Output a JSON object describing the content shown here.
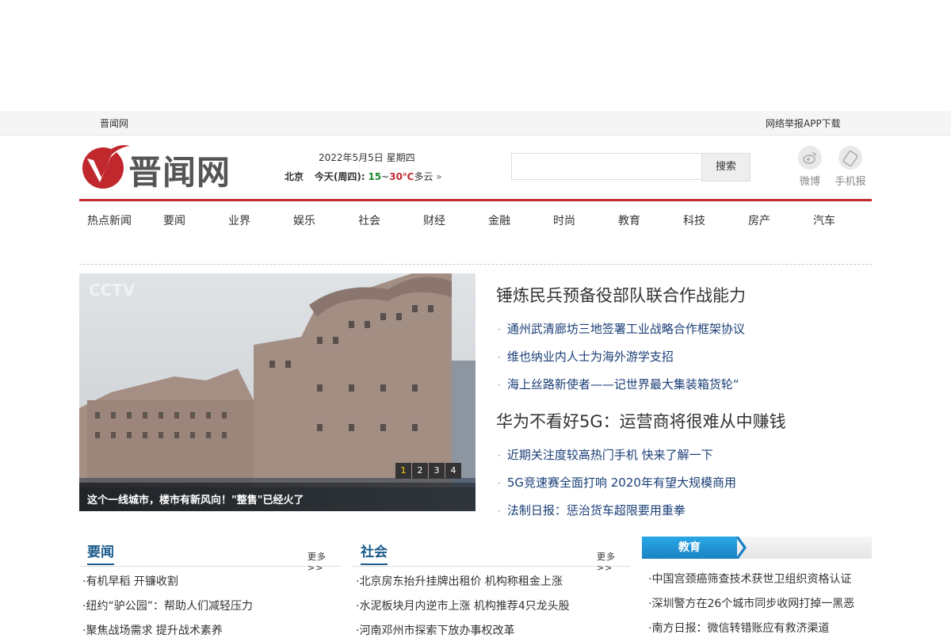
{
  "topbar": {
    "site_name": "晋闻网",
    "app_link": "网络举报APP下载"
  },
  "header": {
    "logo_text": "晋闻网",
    "date": "2022年5月5日  星期四",
    "weather": {
      "city": "北京",
      "today": "今天(周四):",
      "low": "15",
      "sep": "~",
      "high": "30℃",
      "cond": "多云",
      "arrow": "»"
    },
    "search": {
      "placeholder": "",
      "button": "搜索"
    },
    "icons": {
      "weibo": "微博",
      "mobile": "手机报"
    }
  },
  "nav": [
    "热点新闻",
    "要闻",
    "业界",
    "娱乐",
    "社会",
    "财经",
    "金融",
    "时尚",
    "教育",
    "科技",
    "房产",
    "汽车"
  ],
  "slider": {
    "caption": "这个一线城市，楼市有新风向！\"整售\"已经火了",
    "pages": [
      "1",
      "2",
      "3",
      "4"
    ],
    "active_page": 1
  },
  "headlines": [
    {
      "title": "锤炼民兵预备役部队联合作战能力",
      "links": [
        "通州武清廊坊三地签署工业战略合作框架协议",
        "维也纳业内人士为海外游学支招",
        "海上丝路新使者——记世界最大集装箱货轮“"
      ]
    },
    {
      "title": "华为不看好5G：运营商将很难从中赚钱",
      "links": [
        "近期关注度较高热门手机 快来了解一下",
        "5G竞速赛全面打响 2020年有望大规模商用",
        "法制日报：惩治货车超限要用重拳"
      ]
    }
  ],
  "sections": {
    "yaowen": {
      "title": "要闻",
      "more": "更多>>",
      "items": [
        "有机早稻 开镰收割",
        "纽约“驴公园”：帮助人们减轻压力",
        "聚焦战场需求 提升战术素养"
      ]
    },
    "shehui": {
      "title": "社会",
      "more": "更多>>",
      "items": [
        "北京房东抬升挂牌出租价 机构称租金上涨",
        "水泥板块月内逆市上涨 机构推荐4只龙头股",
        "河南邓州市探索下放办事权改革"
      ]
    },
    "jiaoyu": {
      "title": "教育",
      "items": [
        "中国宫颈癌筛查技术获世卫组织资格认证",
        "深圳警方在26个城市同步收网打掉一黑恶",
        "南方日报：微信转错账应有救济渠道"
      ]
    }
  },
  "colors": {
    "accent_red": "#c0282d",
    "link_blue": "#1b3f77",
    "section_blue": "#1b5b8c",
    "edu_tab": "#1a82c4"
  }
}
